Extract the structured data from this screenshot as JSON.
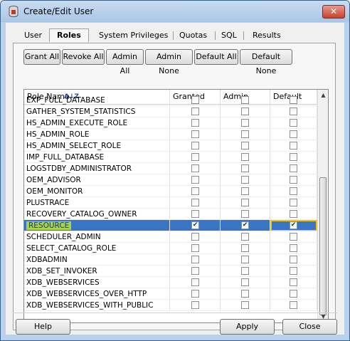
{
  "window": {
    "title": "Create/Edit User",
    "close_glyph": "✕"
  },
  "tabs": [
    "User",
    "Roles",
    "System Privileges",
    "Quotas",
    "SQL",
    "Results"
  ],
  "active_tab": "Roles",
  "toolbar": {
    "grant_all": "Grant All",
    "revoke_all": "Revoke All",
    "admin_all": "Admin All",
    "admin_none": "Admin None",
    "default_all": "Default All",
    "default_none": "Default None"
  },
  "grid": {
    "columns": {
      "role_name": "Role Name",
      "granted": "Granted",
      "admin": "Admin",
      "default": "Default"
    },
    "sort_icon": "sort-az-icon",
    "rows": [
      {
        "name": "EXP_FULL_DATABASE",
        "granted": false,
        "admin": false,
        "default": false
      },
      {
        "name": "GATHER_SYSTEM_STATISTICS",
        "granted": false,
        "admin": false,
        "default": false
      },
      {
        "name": "HS_ADMIN_EXECUTE_ROLE",
        "granted": false,
        "admin": false,
        "default": false
      },
      {
        "name": "HS_ADMIN_ROLE",
        "granted": false,
        "admin": false,
        "default": false
      },
      {
        "name": "HS_ADMIN_SELECT_ROLE",
        "granted": false,
        "admin": false,
        "default": false
      },
      {
        "name": "IMP_FULL_DATABASE",
        "granted": false,
        "admin": false,
        "default": false
      },
      {
        "name": "LOGSTDBY_ADMINISTRATOR",
        "granted": false,
        "admin": false,
        "default": false
      },
      {
        "name": "OEM_ADVISOR",
        "granted": false,
        "admin": false,
        "default": false
      },
      {
        "name": "OEM_MONITOR",
        "granted": false,
        "admin": false,
        "default": false
      },
      {
        "name": "PLUSTRACE",
        "granted": false,
        "admin": false,
        "default": false
      },
      {
        "name": "RECOVERY_CATALOG_OWNER",
        "granted": false,
        "admin": false,
        "default": false
      },
      {
        "name": "RESOURCE",
        "granted": true,
        "admin": true,
        "default": true,
        "selected": true
      },
      {
        "name": "SCHEDULER_ADMIN",
        "granted": false,
        "admin": false,
        "default": false
      },
      {
        "name": "SELECT_CATALOG_ROLE",
        "granted": false,
        "admin": false,
        "default": false
      },
      {
        "name": "XDBADMIN",
        "granted": false,
        "admin": false,
        "default": false
      },
      {
        "name": "XDB_SET_INVOKER",
        "granted": false,
        "admin": false,
        "default": false
      },
      {
        "name": "XDB_WEBSERVICES",
        "granted": false,
        "admin": false,
        "default": false
      },
      {
        "name": "XDB_WEBSERVICES_OVER_HTTP",
        "granted": false,
        "admin": false,
        "default": false
      },
      {
        "name": "XDB_WEBSERVICES_WITH_PUBLIC",
        "granted": false,
        "admin": false,
        "default": false
      }
    ]
  },
  "footer": {
    "help": "Help",
    "apply": "Apply",
    "close": "Close"
  },
  "colors": {
    "selection": "#3a75c4",
    "highlight": "#a7d34b",
    "focus": "#f1c500"
  }
}
